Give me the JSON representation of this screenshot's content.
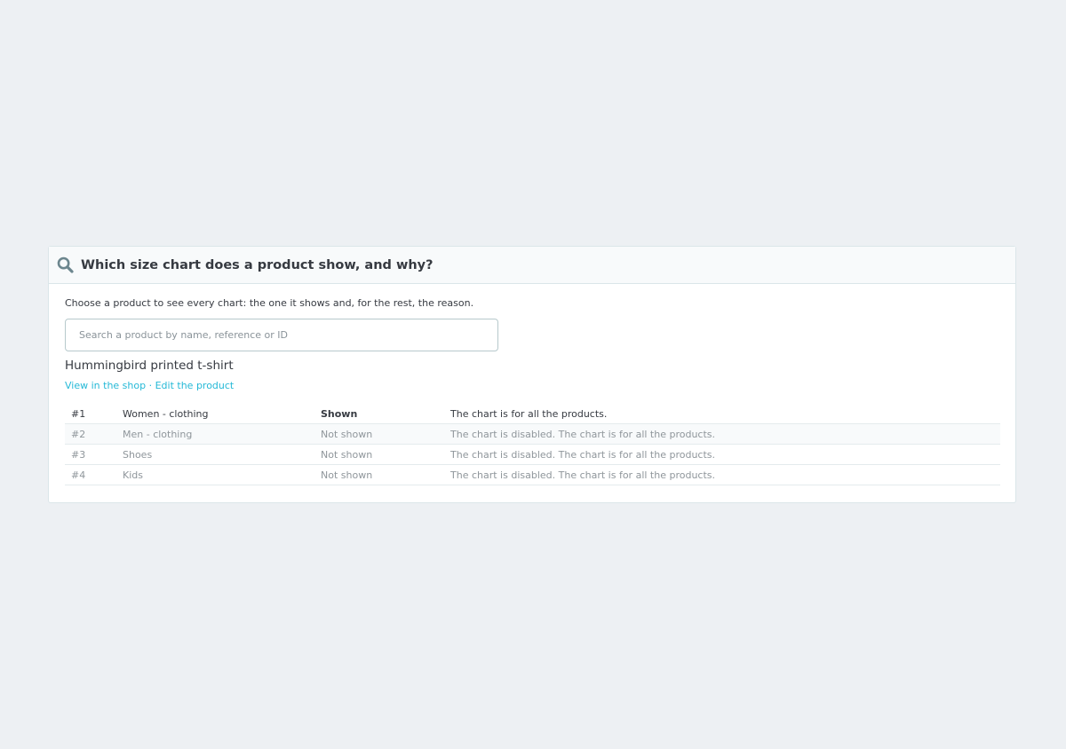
{
  "panel": {
    "title": "Which size chart does a product show, and why?",
    "title_icon": "search-icon",
    "intro": "Choose a product to see every chart: the one it shows and, for the rest, the reason.",
    "search": {
      "placeholder": "Search a product by name, reference or ID",
      "value": ""
    },
    "product": {
      "name": "Hummingbird printed t-shirt",
      "view_link": "View in the shop",
      "separator": "·",
      "edit_link": "Edit the product"
    },
    "charts": [
      {
        "id": "#1",
        "name": "Women - clothing",
        "status": "Shown",
        "reason": "The chart is for all the products."
      },
      {
        "id": "#2",
        "name": "Men - clothing",
        "status": "Not shown",
        "reason": "The chart is disabled. The chart is for all the products."
      },
      {
        "id": "#3",
        "name": "Shoes",
        "status": "Not shown",
        "reason": "The chart is disabled. The chart is for all the products."
      },
      {
        "id": "#4",
        "name": "Kids",
        "status": "Not shown",
        "reason": "The chart is disabled. The chart is for all the products."
      }
    ]
  },
  "colors": {
    "background": "#edf0f3",
    "link": "#25b9d7",
    "text": "#363a41",
    "muted_text": "#8f969b",
    "icon": "#6c868e"
  }
}
